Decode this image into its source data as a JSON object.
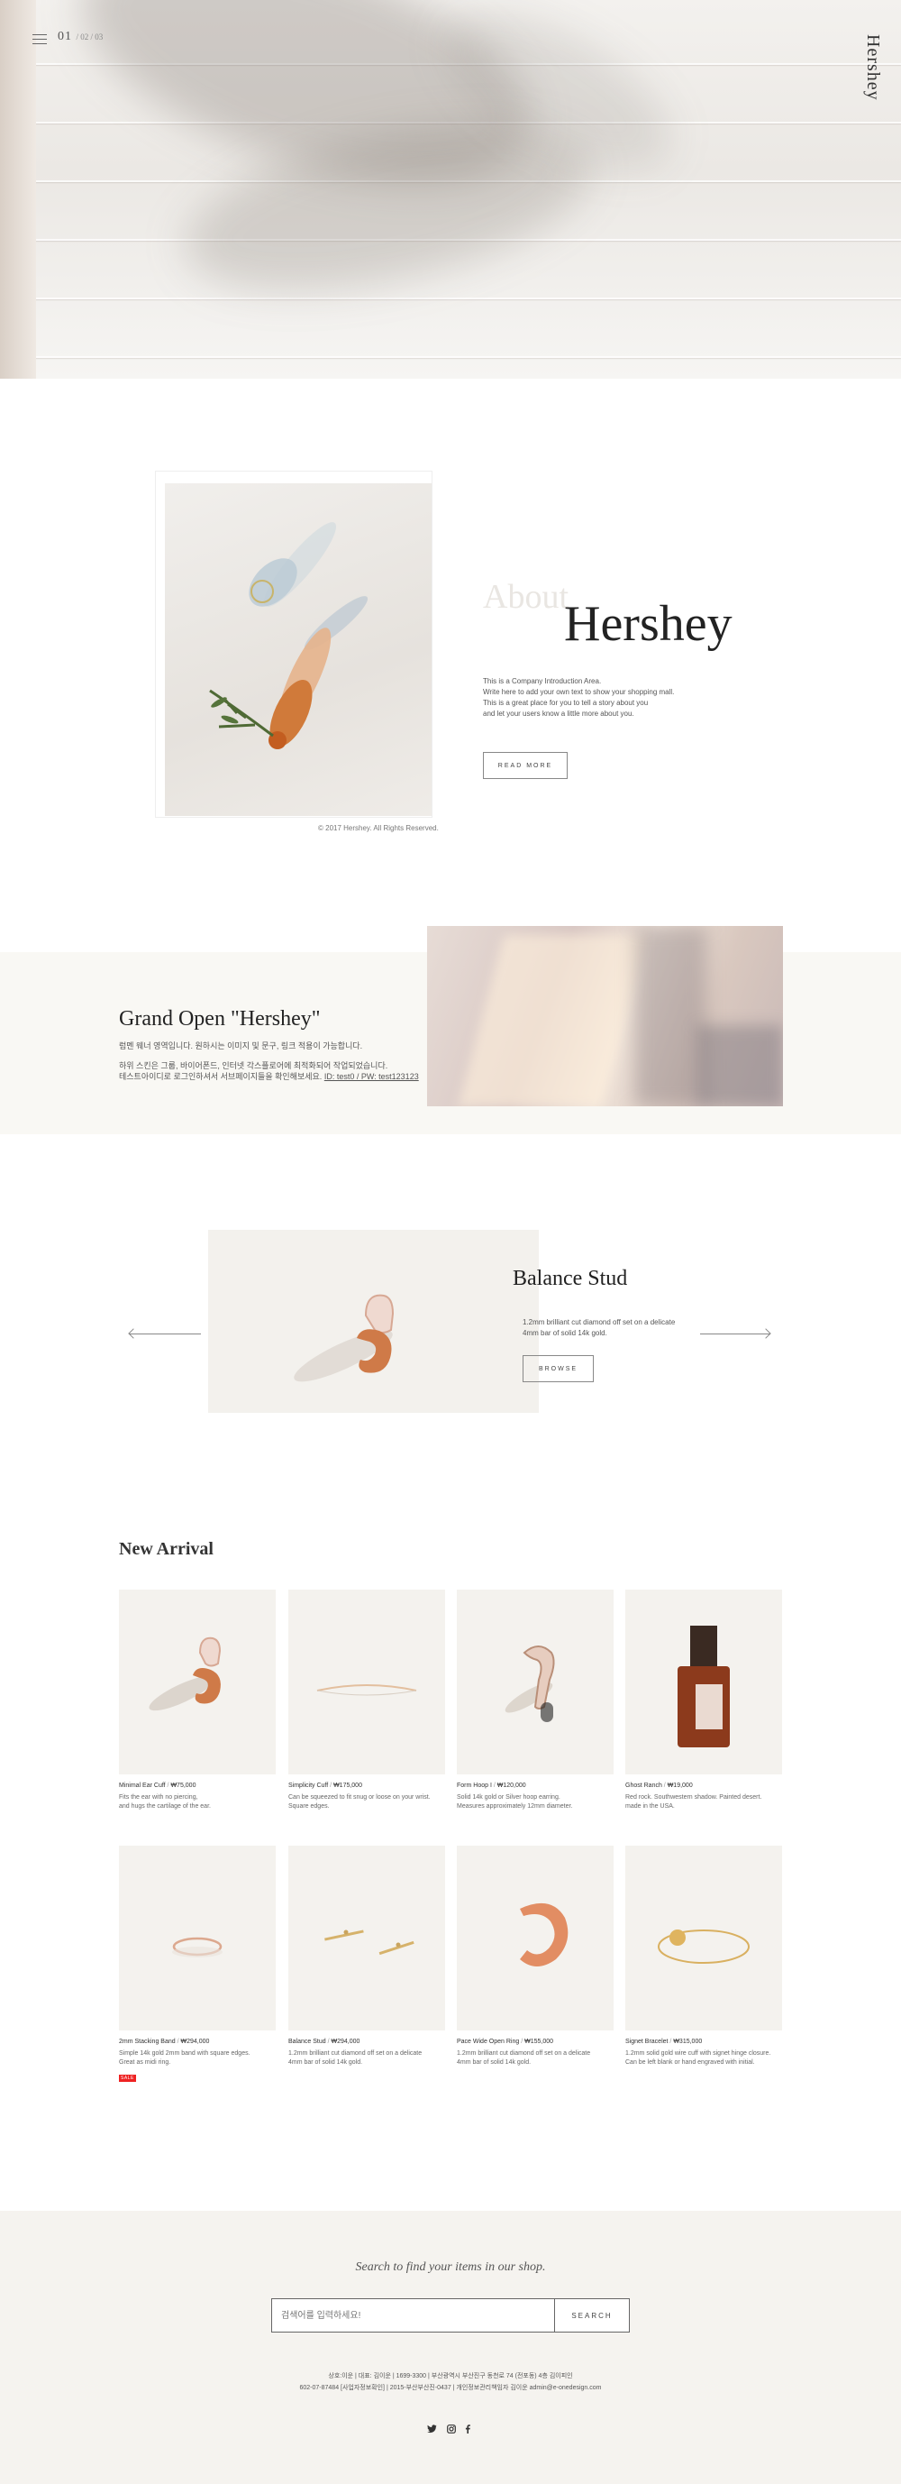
{
  "colors": {
    "background": "#ffffff",
    "band": "#f9f8f4",
    "footer": "#f5f3ef",
    "text": "#333333",
    "badge": "#e22222"
  },
  "header": {
    "menu_icon": "hamburger-icon",
    "slide_current": "01",
    "slide_rest": "/ 02 / 03",
    "brand": "Hershey"
  },
  "about": {
    "ghost": "About",
    "title": "Hershey",
    "lines": [
      "This is a Company Introduction Area.",
      "Write here to add your own text to show your shopping mall.",
      "This is a great place for you to tell a story about you",
      "and let your users know a little more about you."
    ],
    "read_more": "READ MORE",
    "copyright": "© 2017 Hershey. All Rights Reserved."
  },
  "grand_open": {
    "title": "Grand Open \"Hershey\"",
    "line1": "럼멘 웨너 영역입니다. 원하시는 이미지 및 문구, 링크 적용이 가능합니다.",
    "line2": "하위 스킨은 그룹, 바이어폰드, 인터넷 각스플로어에 최적화되어 작업되었습니다.",
    "line3": "테스트아이디로 로그인하셔서 서브페이지들을 확인해보세요.",
    "test_id": "ID: test0 / PW: test123123"
  },
  "slider": {
    "title": "Balance Stud",
    "desc": [
      "1.2mm brilliant cut diamond off set on a delicate",
      "4mm bar of solid 14k gold."
    ],
    "browse": "BROWSE",
    "prev_icon": "arrow-left-icon",
    "next_icon": "arrow-right-icon"
  },
  "new_arrival": {
    "title": "New Arrival",
    "products": [
      {
        "name": "Minimal Ear Cuff",
        "price": "₩75,000",
        "desc": [
          "Fits the ear with no piercing,",
          "and hugs the cartilage of the ear."
        ],
        "badge": ""
      },
      {
        "name": "Simplicity Cuff",
        "price": "₩175,000",
        "desc": [
          "Can be squeezed to fit snug or loose on your wrist.",
          "Square edges."
        ],
        "badge": ""
      },
      {
        "name": "Form Hoop I",
        "price": "₩120,000",
        "desc": [
          "Solid 14k gold or Silver hoop earring.",
          "Measures approximately 12mm diameter."
        ],
        "badge": ""
      },
      {
        "name": "Ghost Ranch",
        "price": "₩19,000",
        "desc": [
          "Red rock. Southwestern shadow. Painted desert.",
          "made in the USA."
        ],
        "badge": ""
      },
      {
        "name": "2mm Stacking Band",
        "price": "₩294,000",
        "desc": [
          "Simple 14k gold 2mm band with square edges.",
          "Great as midi ring."
        ],
        "badge": "SALE"
      },
      {
        "name": "Balance Stud",
        "price": "₩294,000",
        "desc": [
          "1.2mm brilliant cut diamond off set on a delicate",
          "4mm bar of solid 14k gold."
        ],
        "badge": ""
      },
      {
        "name": "Pace Wide Open Ring",
        "price": "₩155,000",
        "desc": [
          "1.2mm brilliant cut diamond off set on a delicate",
          "4mm bar of solid 14k gold."
        ],
        "badge": ""
      },
      {
        "name": "Signet Bracelet",
        "price": "₩315,000",
        "desc": [
          "1.2mm solid gold wire cuff with signet hinge closure.",
          "Can be left blank or hand engraved with initial."
        ],
        "badge": ""
      }
    ]
  },
  "footer": {
    "search_caption": "Search to find your items in our shop.",
    "search_placeholder": "검색어를 입력하세요!",
    "search_button": "SEARCH",
    "info_line1": "상호:이운  |  대표: 김이운  |  1699-3300  |  부산광역시 부산진구 동천로 74 (전포동) 4층 김이피인",
    "info_line2": "602-07-87484 [사업자정보확인]  |  2015-부산부산진-0437  |  개인정보관리책임자 김이운 admin@e-onedesign.com",
    "social_icons": [
      "twitter-icon",
      "instagram-icon",
      "facebook-icon"
    ]
  }
}
